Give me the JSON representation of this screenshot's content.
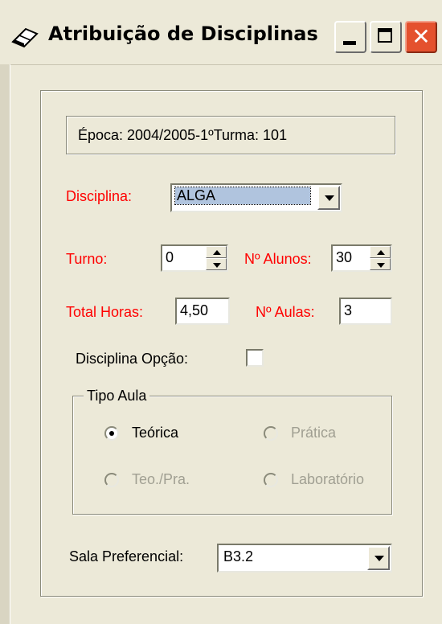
{
  "window": {
    "title": "Atribuição de Disciplinas",
    "icons": {
      "app": "eraser-icon",
      "minimize": "minimize-icon",
      "maximize": "maximize-icon",
      "close": "close-icon"
    },
    "close_glyph": "✕"
  },
  "info": {
    "text": "Época: 2004/2005-1ºTurma: 101"
  },
  "form": {
    "disciplina": {
      "label": "Disciplina:",
      "value": "ALGA"
    },
    "turno": {
      "label": "Turno:",
      "value": "0"
    },
    "num_alunos": {
      "label": "Nº Alunos:",
      "value": "30"
    },
    "total_horas": {
      "label": "Total Horas:",
      "value": "4,50"
    },
    "num_aulas": {
      "label": "Nº Aulas:",
      "value": "3"
    },
    "disciplina_opcao": {
      "label": "Disciplina Opção:",
      "checked": false
    },
    "tipo_aula": {
      "title": "Tipo Aula",
      "options": [
        {
          "label": "Teórica",
          "selected": true,
          "enabled": true
        },
        {
          "label": "Prática",
          "selected": false,
          "enabled": false
        },
        {
          "label": "Teo./Pra.",
          "selected": false,
          "enabled": false
        },
        {
          "label": "Laboratório",
          "selected": false,
          "enabled": false
        }
      ]
    },
    "sala_preferencial": {
      "label": "Sala Preferencial:",
      "value": "B3.2"
    }
  },
  "colors": {
    "required_label": "#ff0000",
    "disabled_text": "#a09f92",
    "window_bg": "#ece9d8"
  }
}
